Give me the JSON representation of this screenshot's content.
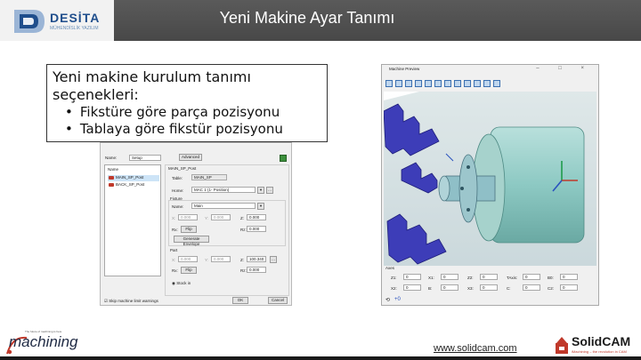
{
  "header": {
    "title": "Yeni Makine Ayar Tanımı",
    "logo_text": "DESİTA",
    "logo_subtitle": "MÜHENDİSLİK YAZILIM"
  },
  "callout": {
    "heading": "Yeni makine kurulum tanımı seçenekleri:",
    "bullets": [
      "Fikstüre göre parça pozisyonu",
      "Tablaya göre fikstür pozisyonu"
    ]
  },
  "setup_dialog": {
    "name_label": "Name:",
    "name_value": "Setup",
    "advanced_button": "Advanced",
    "tree_header": "Name",
    "tree_items": [
      "MAIN_SP_Post",
      "BACK_SP_Post"
    ],
    "group_title": "MAIN_SP_Post",
    "table_label": "Table:",
    "table_value": "MAIN_SP",
    "home_label": "Home:",
    "home_value": "MAC 1 (1- Position)",
    "fixture_title": "Fixture",
    "fixture_name_label": "Name:",
    "fixture_name_value": "Main",
    "fx_labels": [
      "X:",
      "Y:",
      "Z:"
    ],
    "fx_values": [
      "0.000",
      "0.000",
      "0.000"
    ],
    "rx_label": "Rx:",
    "flip_label": "Flip",
    "rz_label": "Rz:",
    "rz_value": "0.000",
    "generate_button": "Generate Envelope",
    "part_title": "Part",
    "part_labels": [
      "X:",
      "Y:",
      "Z:"
    ],
    "part_values": [
      "0.000",
      "0.000",
      "100.340"
    ],
    "part_rz_value": "0.000",
    "stock_label": "Stock in",
    "skip_label": "Skip machine limit warnings",
    "ok_button": "OK",
    "cancel_button": "Cancel"
  },
  "preview": {
    "title": "Machine Preview",
    "window_controls": "– □ ×",
    "axes_title": "Axes",
    "axis_labels": [
      "Z1:",
      "X1:",
      "Z2:",
      "TAxis:",
      "B0:",
      "X2:",
      "B:",
      "X3:",
      "C:",
      "C2:"
    ],
    "axis_values": [
      "0",
      "0",
      "0",
      "0",
      "0",
      "0",
      "0",
      "0",
      "0",
      "0"
    ],
    "bottom_readout": "+0"
  },
  "footer": {
    "url": "www.solidcam.com",
    "imachining_name": "machining",
    "imachining_tag": "The future of machining is here",
    "solidcam_name": "SolidCAM",
    "solidcam_tag": "iMachining – the revolution in CAM"
  }
}
